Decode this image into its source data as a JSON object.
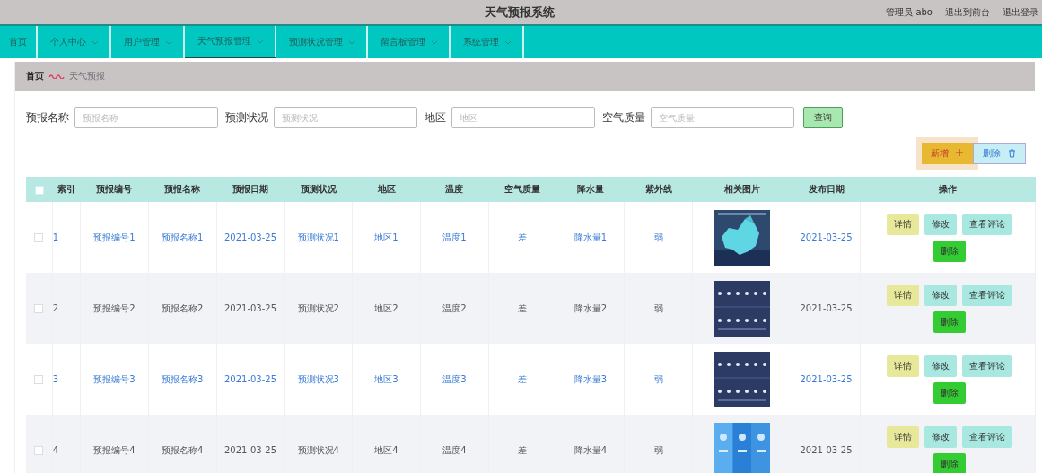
{
  "header": {
    "title": "天气预报系统",
    "links": [
      "管理员 abo",
      "退出到前台",
      "退出登录"
    ]
  },
  "nav": [
    {
      "label": "首页",
      "dropdown": false,
      "selected": false
    },
    {
      "label": "个人中心",
      "dropdown": true,
      "selected": false
    },
    {
      "label": "用户管理",
      "dropdown": true,
      "selected": false
    },
    {
      "label": "天气预报管理",
      "dropdown": true,
      "selected": true
    },
    {
      "label": "预测状况管理",
      "dropdown": true,
      "selected": false
    },
    {
      "label": "留言板管理",
      "dropdown": true,
      "selected": false
    },
    {
      "label": "系统管理",
      "dropdown": true,
      "selected": false
    }
  ],
  "breadcrumb": {
    "home": "首页",
    "current": "天气预报"
  },
  "search": {
    "fields": [
      {
        "label": "预报名称",
        "placeholder": "预报名称"
      },
      {
        "label": "预测状况",
        "placeholder": "预测状况"
      },
      {
        "label": "地区",
        "placeholder": "地区"
      },
      {
        "label": "空气质量",
        "placeholder": "空气质量"
      }
    ],
    "button": "查询"
  },
  "toolbar": [
    {
      "label": "新增",
      "kind": "add"
    },
    {
      "label": "删除",
      "kind": "delete"
    }
  ],
  "table": {
    "select_all_checked": false,
    "columns": [
      {
        "label": "索引",
        "kind": "text"
      },
      {
        "label": "预报编号",
        "kind": "text"
      },
      {
        "label": "预报名称",
        "kind": "text"
      },
      {
        "label": "预报日期",
        "kind": "text"
      },
      {
        "label": "预测状况",
        "kind": "text"
      },
      {
        "label": "地区",
        "kind": "text"
      },
      {
        "label": "温度",
        "kind": "text"
      },
      {
        "label": "空气质量",
        "kind": "text"
      },
      {
        "label": "降水量",
        "kind": "text"
      },
      {
        "label": "紫外线",
        "kind": "text"
      },
      {
        "label": "相关图片",
        "kind": "picture"
      },
      {
        "label": "发布日期",
        "kind": "text"
      },
      {
        "label": "操作",
        "kind": "actions"
      }
    ],
    "rows": [
      {
        "checked": false,
        "shaded": false,
        "cells": [
          "1",
          "预报编号1",
          "预报名称1",
          "2021-03-25",
          "预测状况1",
          "地区1",
          "温度1",
          "差",
          "降水量1",
          "弱",
          "2021-03-25"
        ],
        "actions": [
          {
            "label": "详情",
            "kind": "detail"
          },
          {
            "label": "修改",
            "kind": "edit"
          },
          {
            "label": "查看评论",
            "kind": "comments"
          },
          {
            "label": "删除",
            "kind": "delete"
          }
        ]
      },
      {
        "checked": false,
        "shaded": true,
        "cells": [
          "2",
          "预报编号2",
          "预报名称2",
          "2021-03-25",
          "预测状况2",
          "地区2",
          "温度2",
          "差",
          "降水量2",
          "弱",
          "2021-03-25"
        ],
        "actions": [
          {
            "label": "详情",
            "kind": "detail"
          },
          {
            "label": "修改",
            "kind": "edit"
          },
          {
            "label": "查看评论",
            "kind": "comments"
          },
          {
            "label": "删除",
            "kind": "delete"
          }
        ]
      },
      {
        "checked": false,
        "shaded": false,
        "cells": [
          "3",
          "预报编号3",
          "预报名称3",
          "2021-03-25",
          "预测状况3",
          "地区3",
          "温度3",
          "差",
          "降水量3",
          "弱",
          "2021-03-25"
        ],
        "actions": [
          {
            "label": "详情",
            "kind": "detail"
          },
          {
            "label": "修改",
            "kind": "edit"
          },
          {
            "label": "查看评论",
            "kind": "comments"
          },
          {
            "label": "删除",
            "kind": "delete"
          }
        ]
      },
      {
        "checked": false,
        "shaded": true,
        "cells": [
          "4",
          "预报编号4",
          "预报名称4",
          "2021-03-25",
          "预测状况4",
          "地区4",
          "温度4",
          "差",
          "降水量4",
          "弱",
          "2021-03-25"
        ],
        "actions": [
          {
            "label": "详情",
            "kind": "detail"
          },
          {
            "label": "修改",
            "kind": "edit"
          },
          {
            "label": "查看评论",
            "kind": "comments"
          },
          {
            "label": "删除",
            "kind": "delete"
          }
        ]
      }
    ]
  }
}
